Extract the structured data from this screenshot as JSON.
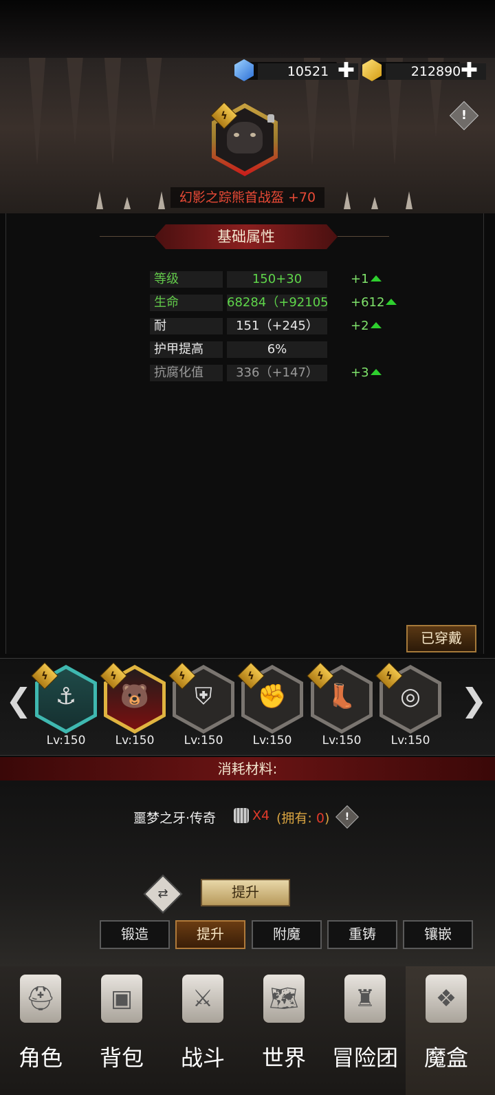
{
  "currency": {
    "gems": "10521",
    "gold": "212890",
    "add_symbol": "✚"
  },
  "item": {
    "name": "幻影之踪熊首战盔 +70",
    "warning_symbol": "!"
  },
  "attributes": {
    "title": "基础属性",
    "rows": [
      {
        "label": "等级",
        "value": "150+30",
        "increase": "+1",
        "label_color": "#62c94a",
        "value_color": "#5fd64a"
      },
      {
        "label": "生命",
        "value": "68284（+92105",
        "increase": "+612",
        "label_color": "#62c94a",
        "value_color": "#5fd64a"
      },
      {
        "label": "耐",
        "value": "151（+245）",
        "increase": "+2",
        "label_color": "#e8e8e8",
        "value_color": "#e8e8e8"
      },
      {
        "label": "护甲提高",
        "value": "6%",
        "increase": "",
        "label_color": "#e8e8e8",
        "value_color": "#e8e8e8"
      },
      {
        "label": "抗腐化值",
        "value": "336（+147）",
        "increase": "+3",
        "label_color": "#9a9a9a",
        "value_color": "#9a9a9a"
      }
    ]
  },
  "equipped_label": "已穿戴",
  "carousel": {
    "prev": "❮",
    "next": "❯",
    "slots": [
      {
        "level": "Lv:150",
        "icon": "necklace-icon",
        "glyph": "⚓",
        "border": "#3fb8b0"
      },
      {
        "level": "Lv:150",
        "icon": "bear-helmet-icon",
        "glyph": "🐻",
        "border": "#e0b440"
      },
      {
        "level": "Lv:150",
        "icon": "armor-icon",
        "glyph": "⛨",
        "border": "#7a7570"
      },
      {
        "level": "Lv:150",
        "icon": "gauntlet-icon",
        "glyph": "✊",
        "border": "#7a7570"
      },
      {
        "level": "Lv:150",
        "icon": "boots-icon",
        "glyph": "👢",
        "border": "#7a7570"
      },
      {
        "level": "Lv:150",
        "icon": "ring-icon",
        "glyph": "◎",
        "border": "#7a7570"
      }
    ]
  },
  "materials": {
    "title": "消耗材料:",
    "name": "噩梦之牙·传奇",
    "count": "X4",
    "owned_prefix": "(拥有: ",
    "owned_value": "0",
    "owned_suffix": ")"
  },
  "actions": {
    "upgrade_button": "提升",
    "tabs": [
      "锻造",
      "提升",
      "附魔",
      "重铸",
      "镶嵌"
    ],
    "active_tab": 1
  },
  "nav": [
    {
      "label": "角色",
      "icon": "helmet-icon"
    },
    {
      "label": "背包",
      "icon": "backpack-icon"
    },
    {
      "label": "战斗",
      "icon": "shield-sword-icon"
    },
    {
      "label": "世界",
      "icon": "map-icon"
    },
    {
      "label": "冒险团",
      "icon": "castle-icon"
    },
    {
      "label": "魔盒",
      "icon": "magic-box-icon"
    }
  ]
}
